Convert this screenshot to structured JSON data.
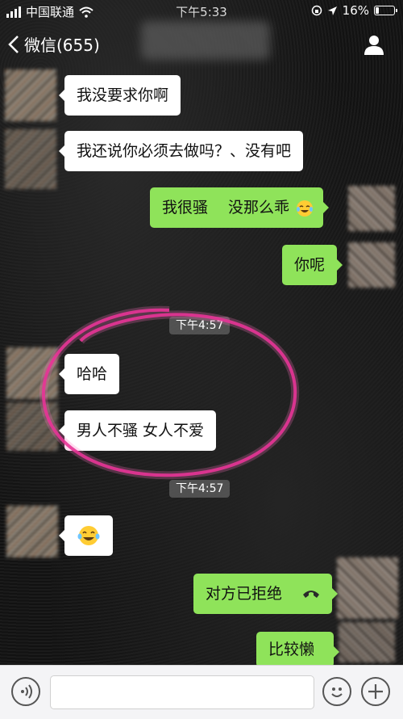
{
  "status": {
    "carrier": "中国联通",
    "time": "下午5:33",
    "battery": "16%"
  },
  "nav": {
    "back_label": "微信(655)"
  },
  "messages": {
    "m1": "我没要求你啊",
    "m2": "我还说你必须去做吗？、没有吧",
    "m3": "我很骚　 没那么乖",
    "m4": "你呢",
    "t1": "下午4:57",
    "m5": "哈哈",
    "m6": "男人不骚 女人不爱",
    "t2": "下午4:57",
    "m8": "对方已拒绝",
    "m9": "比较懒"
  },
  "icons": {
    "back": "chevron-left-icon",
    "profile": "person-icon",
    "voice": "voice-icon",
    "emoji": "smiley-icon",
    "plus": "plus-icon",
    "tears_of_joy": "tears-of-joy-emoji"
  },
  "colors": {
    "sent_bubble": "#8fe35a",
    "received_bubble": "#ffffff",
    "annotation": "#e0208a"
  }
}
